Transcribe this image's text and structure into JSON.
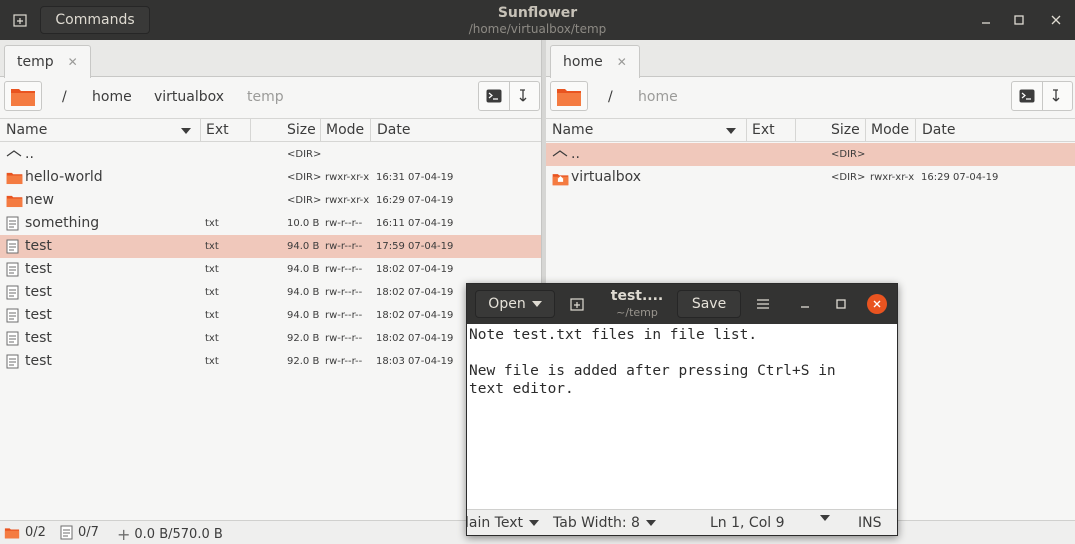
{
  "app": {
    "title": "Sunflower",
    "subtitle": "/home/virtualbox/temp",
    "commands_label": "Commands"
  },
  "left_pane": {
    "tab_label": "temp",
    "breadcrumb": [
      "/",
      "home",
      "virtualbox",
      "temp"
    ],
    "columns": [
      "Name",
      "Ext",
      "Size",
      "Mode",
      "Date"
    ],
    "rows": [
      {
        "icon": "parent-dir-icon",
        "name": "..",
        "ext": "",
        "size": "<DIR>",
        "mode": "",
        "date": ""
      },
      {
        "icon": "folder-icon",
        "name": "hello-world",
        "ext": "",
        "size": "<DIR>",
        "mode": "rwxr-xr-x",
        "date": "16:31 07-04-19"
      },
      {
        "icon": "folder-icon",
        "name": "new",
        "ext": "",
        "size": "<DIR>",
        "mode": "rwxr-xr-x",
        "date": "16:29 07-04-19"
      },
      {
        "icon": "file-icon",
        "name": "something",
        "ext": "txt",
        "size": "10.0 B",
        "mode": "rw-r--r--",
        "date": "16:11 07-04-19"
      },
      {
        "icon": "file-icon",
        "name": "test",
        "ext": "txt",
        "size": "94.0 B",
        "mode": "rw-r--r--",
        "date": "17:59 07-04-19",
        "selected": true
      },
      {
        "icon": "file-icon",
        "name": "test",
        "ext": "txt",
        "size": "94.0 B",
        "mode": "rw-r--r--",
        "date": "18:02 07-04-19"
      },
      {
        "icon": "file-icon",
        "name": "test",
        "ext": "txt",
        "size": "94.0 B",
        "mode": "rw-r--r--",
        "date": "18:02 07-04-19"
      },
      {
        "icon": "file-icon",
        "name": "test",
        "ext": "txt",
        "size": "94.0 B",
        "mode": "rw-r--r--",
        "date": "18:02 07-04-19"
      },
      {
        "icon": "file-icon",
        "name": "test",
        "ext": "txt",
        "size": "92.0 B",
        "mode": "rw-r--r--",
        "date": "18:02 07-04-19"
      },
      {
        "icon": "file-icon",
        "name": "test",
        "ext": "txt",
        "size": "92.0 B",
        "mode": "rw-r--r--",
        "date": "18:03 07-04-19"
      }
    ],
    "status": {
      "dirs": "0/2",
      "files": "0/7",
      "size": "0.0 B/570.0 B"
    }
  },
  "right_pane": {
    "tab_label": "home",
    "breadcrumb": [
      "/",
      "home"
    ],
    "columns": [
      "Name",
      "Ext",
      "Size",
      "Mode",
      "Date"
    ],
    "rows": [
      {
        "icon": "parent-dir-icon",
        "name": "..",
        "ext": "",
        "size": "<DIR>",
        "mode": "",
        "date": "",
        "selected": true
      },
      {
        "icon": "home-folder-icon",
        "name": "virtualbox",
        "ext": "",
        "size": "<DIR>",
        "mode": "rwxr-xr-x",
        "date": "16:29 07-04-19"
      }
    ]
  },
  "editor": {
    "open_label": "Open",
    "title": "test....",
    "subtitle": "~/temp",
    "save_label": "Save",
    "text": "Note test.txt files in file list.\n\nNew file is added after pressing Ctrl+S in\ntext editor.",
    "language": "lain Text",
    "tab_width": "Tab Width: 8",
    "position": "Ln 1, Col 9",
    "mode": "INS"
  },
  "colors": {
    "selection": "#f0c8bb",
    "folder": "#e95420",
    "titlebar": "#333332"
  }
}
